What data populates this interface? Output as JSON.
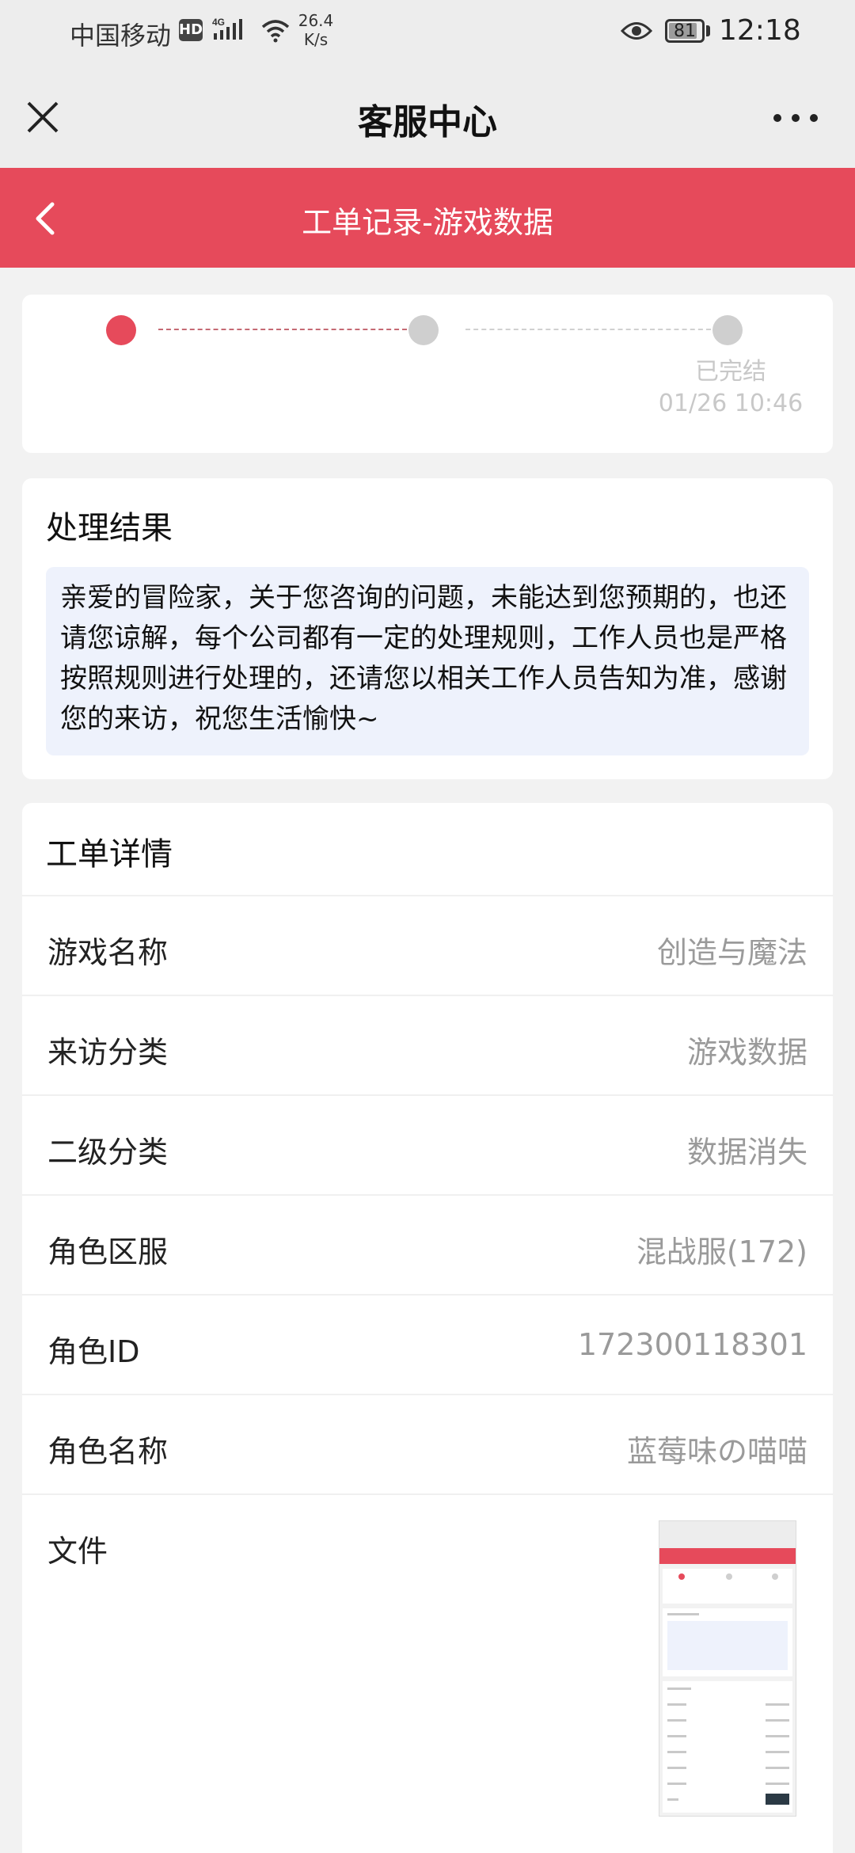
{
  "status_bar": {
    "carrier": "中国移动",
    "hd": "HD",
    "net_speed_value": "26.4",
    "net_speed_unit": "K/s",
    "battery": "81",
    "time": "12:18"
  },
  "titlebar": {
    "title": "客服中心"
  },
  "header": {
    "title": "工单记录-游戏数据"
  },
  "progress": {
    "steps_done": 1,
    "step_total": 3,
    "final_label": "已完结",
    "final_time": "01/26 10:46"
  },
  "result": {
    "title": "处理结果",
    "text": "亲爱的冒险家，关于您咨询的问题，未能达到您预期的，也还请您谅解，每个公司都有一定的处理规则，工作人员也是严格按照规则进行处理的，还请您以相关工作人员告知为准，感谢您的来访，祝您生活愉快~"
  },
  "details": {
    "title": "工单详情",
    "rows": [
      {
        "label": "游戏名称",
        "value": "创造与魔法"
      },
      {
        "label": "来访分类",
        "value": "游戏数据"
      },
      {
        "label": "二级分类",
        "value": "数据消失"
      },
      {
        "label": "角色区服",
        "value": "混战服(172)"
      },
      {
        "label": "角色ID",
        "value": "172300118301"
      },
      {
        "label": "角色名称",
        "value": "蓝莓味の喵喵"
      }
    ],
    "file_label": "文件"
  },
  "colors": {
    "accent": "#e64a5b",
    "result_bg": "#eef2fc",
    "inactive_dot": "#cfcfcf"
  },
  "icons": {
    "close": "close-icon",
    "more": "more-icon",
    "back": "back-chevron-icon"
  }
}
